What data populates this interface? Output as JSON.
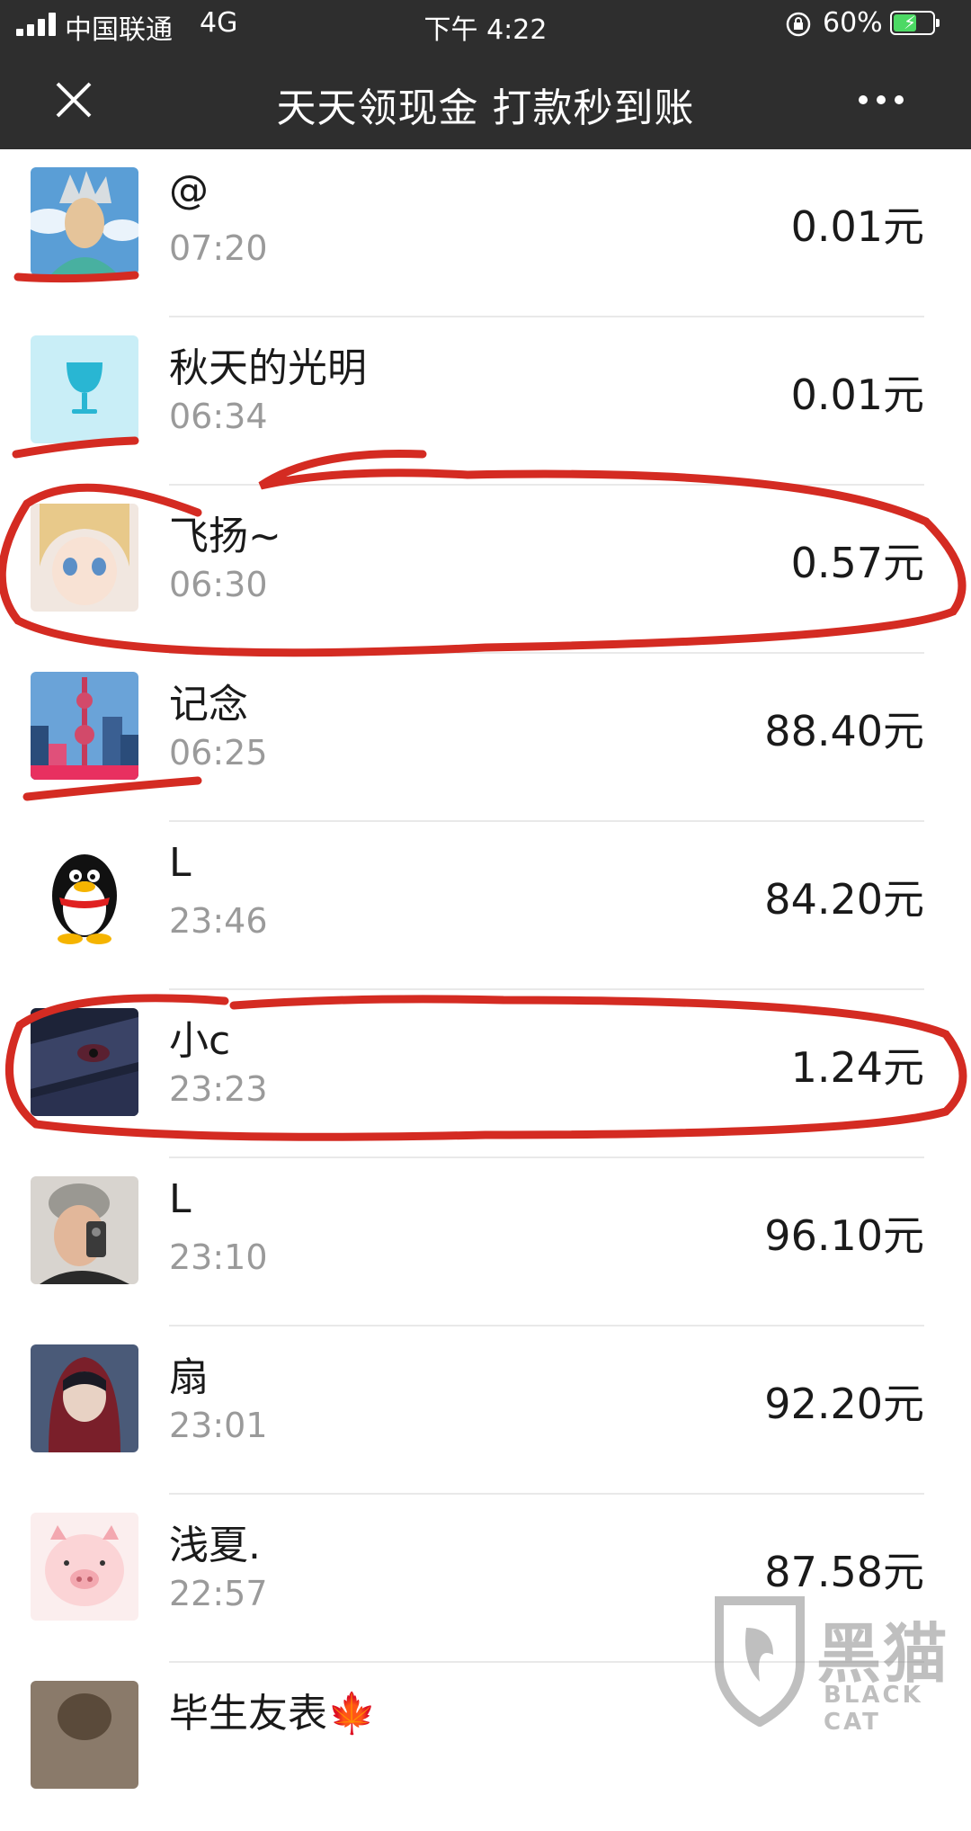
{
  "status_bar": {
    "carrier": "中国联通",
    "network": "4G",
    "time": "下午 4:22",
    "battery_percent": "60%",
    "battery_level": 0.6,
    "icons": [
      "signal-icon",
      "rotation-lock-icon",
      "battery-charging-icon"
    ]
  },
  "nav": {
    "title": "天天领现金 打款秒到账",
    "close_icon": "close-icon",
    "more_icon": "more-icon"
  },
  "colors": {
    "header_bg": "#2e2e2e",
    "annotation_red": "#d42b22",
    "amount_text": "#1a1a1a",
    "time_text": "#9a9a9a"
  },
  "list": {
    "rows": [
      {
        "name": "@",
        "time": "07:20",
        "amount": "0.01元"
      },
      {
        "name": "秋天的光明",
        "time": "06:34",
        "amount": "0.01元"
      },
      {
        "name": "飞扬~",
        "time": "06:30",
        "amount": "0.57元"
      },
      {
        "name": "记念",
        "time": "06:25",
        "amount": "88.40元"
      },
      {
        "name": "L",
        "time": "23:46",
        "amount": "84.20元"
      },
      {
        "name": "小c",
        "time": "23:23",
        "amount": "1.24元"
      },
      {
        "name": "L",
        "time": "23:10",
        "amount": "96.10元"
      },
      {
        "name": "扇",
        "time": "23:01",
        "amount": "92.20元"
      },
      {
        "name": "浅夏.",
        "time": "22:57",
        "amount": "87.58元"
      },
      {
        "name": "毕生友表🍁",
        "time": "",
        "amount": ""
      }
    ]
  },
  "watermark": {
    "text": "黑猫",
    "sub": "BLACK CAT"
  }
}
